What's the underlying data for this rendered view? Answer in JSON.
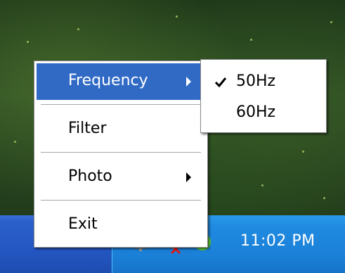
{
  "menu": {
    "items": [
      {
        "label": "Frequency",
        "has_submenu": true,
        "highlighted": true
      },
      {
        "label": "Filter",
        "has_submenu": false,
        "highlighted": false
      },
      {
        "label": "Photo",
        "has_submenu": true,
        "highlighted": false
      },
      {
        "label": "Exit",
        "has_submenu": false,
        "highlighted": false
      }
    ]
  },
  "submenu": {
    "items": [
      {
        "label": "50Hz",
        "checked": true,
        "check_icon": "checkmark-icon"
      },
      {
        "label": "60Hz",
        "checked": false
      }
    ]
  },
  "tray": {
    "time": "11:02 PM",
    "icons": [
      "network-icon",
      "volume-muted-icon",
      "recycle-app-icon"
    ]
  },
  "colors": {
    "highlight": "#316ac5",
    "taskbar": "#2457c2",
    "tray": "#1b80d8"
  }
}
